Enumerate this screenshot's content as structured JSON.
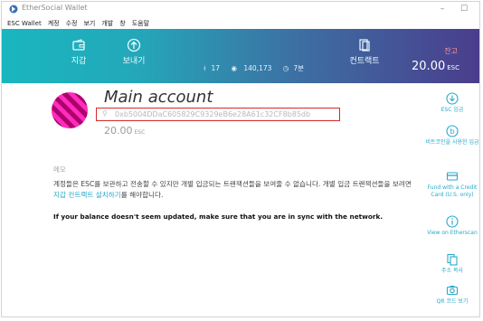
{
  "window": {
    "title": "EtherSocial Wallet",
    "minimize": "–",
    "maximize": "☐"
  },
  "menubar": {
    "items": [
      "ESC Wallet",
      "계정",
      "수정",
      "보기",
      "개발",
      "창",
      "도움말"
    ]
  },
  "header": {
    "nav": [
      {
        "label": "지갑",
        "icon": "wallet-icon"
      },
      {
        "label": "보내기",
        "icon": "send-arrow-icon"
      },
      {
        "label": "컨트랙트",
        "icon": "contract-icon"
      }
    ],
    "peers": "17",
    "block": "140,173",
    "time_ago": "7분",
    "balance_label": "잔고",
    "balance_value": "20.00",
    "balance_unit": "ESC",
    "accent_colors": [
      "#19b6bf",
      "#4a3d8c"
    ]
  },
  "account": {
    "name": "Main account",
    "address": "0xb5004DDaC605829C9329eB6e28A61c32CF8b85db",
    "balance": "20.00",
    "unit": "ESC",
    "avatar_colors": [
      "#ff2dbb",
      "#b0006e"
    ]
  },
  "memo": {
    "label": "메모",
    "text_before": "계정들은 ESC를 보관하고 전송할 수 있지만 개별 입금되는 트랜잭션들을 보여줄 수 없습니다. 개별 입금 트랜잭션들을 보려면 ",
    "link": "지갑 컨트랙트 설치하기",
    "text_after": "를 해야합니다.",
    "warning": "If your balance doesn't seem updated, make sure that you are in sync with the network.",
    "link_color": "#2aa8c9"
  },
  "sidebar": {
    "items": [
      {
        "label": "ESC 입금",
        "icon": "download-icon"
      },
      {
        "label": "비트코인을 사용한 입금",
        "icon": "bitcoin-icon"
      },
      {
        "label": "Fund with a Credit Card (U.S. only)",
        "icon": "credit-card-icon"
      },
      {
        "label": "View on Etherscan",
        "icon": "info-icon"
      },
      {
        "label": "주소 복사",
        "icon": "copy-icon"
      },
      {
        "label": "QR 코드 보기",
        "icon": "qr-camera-icon"
      }
    ]
  }
}
